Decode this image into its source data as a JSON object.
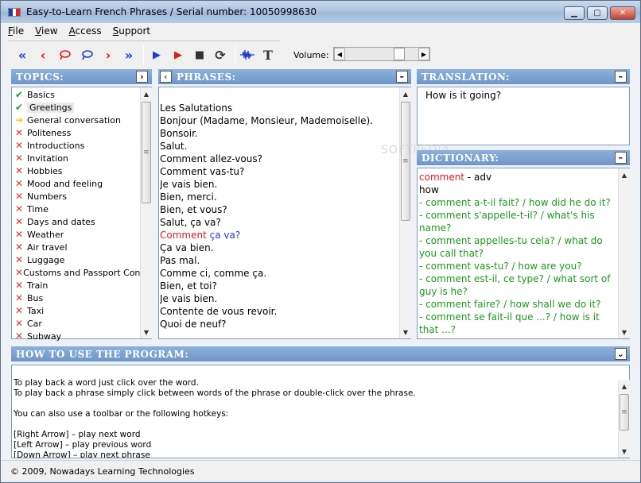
{
  "window": {
    "title": "Easy-to-Learn French Phrases / Serial number: 10050998630",
    "flag_colors": [
      "#1f3fa8",
      "#ffffff",
      "#e0262a"
    ]
  },
  "menu": [
    {
      "label": "File",
      "accel": "F",
      "rest": "ile"
    },
    {
      "label": "View",
      "accel": "V",
      "rest": "iew"
    },
    {
      "label": "Access",
      "accel": "A",
      "rest": "ccess"
    },
    {
      "label": "Support",
      "accel": "S",
      "rest": "upport"
    }
  ],
  "toolbar": {
    "first_glyph": "«",
    "prev_glyph": "‹",
    "next_glyph": "›",
    "last_glyph": "»",
    "play_glyph": "▶",
    "stop_glyph": "■",
    "repeat_glyph": "⟳",
    "wave_glyph": "∿",
    "text_glyph": "T",
    "volume_label": "Volume:",
    "volume_level": 0.78
  },
  "topics": {
    "header": "TOPICS:",
    "items": [
      {
        "label": "Basics",
        "status": "done"
      },
      {
        "label": "Greetings",
        "status": "done"
      },
      {
        "label": "General conversation",
        "status": "current"
      },
      {
        "label": "Politeness",
        "status": "locked"
      },
      {
        "label": "Introductions",
        "status": "locked"
      },
      {
        "label": "Invitation",
        "status": "locked"
      },
      {
        "label": "Hobbies",
        "status": "locked"
      },
      {
        "label": "Mood and feeling",
        "status": "locked"
      },
      {
        "label": "Numbers",
        "status": "locked"
      },
      {
        "label": "Time",
        "status": "locked"
      },
      {
        "label": "Days and dates",
        "status": "locked"
      },
      {
        "label": "Weather",
        "status": "locked"
      },
      {
        "label": "Air travel",
        "status": "locked"
      },
      {
        "label": "Luggage",
        "status": "locked"
      },
      {
        "label": "Customs and Passport Con...",
        "status": "locked"
      },
      {
        "label": "Train",
        "status": "locked"
      },
      {
        "label": "Bus",
        "status": "locked"
      },
      {
        "label": "Taxi",
        "status": "locked"
      },
      {
        "label": "Car",
        "status": "locked"
      },
      {
        "label": "Subway",
        "status": "locked"
      }
    ]
  },
  "phrases": {
    "header": "PHRASES:",
    "lines": [
      "Les Salutations",
      "",
      "Bonjour (Madame, Monsieur, Mademoiselle).",
      "Bonsoir.",
      "Salut.",
      "Comment allez-vous?",
      "Comment vas-tu?",
      "Je vais bien.",
      "Bien, merci.",
      "Bien, et vous?",
      "Salut, ça va?",
      "",
      "Ça va bien.",
      "Pas mal.",
      "Comme ci, comme ça.",
      "Bien, et toi?",
      "Je vais bien.",
      "Contente de vous revoir.",
      "Quoi de neuf?"
    ],
    "highlight": {
      "word": "Comment",
      "rest": " ça va?"
    }
  },
  "translation": {
    "header": "TRANSLATION:",
    "text": "How is it going?"
  },
  "dictionary": {
    "header": "DICTIONARY:",
    "word": "comment",
    "pos": " - adv",
    "meaning": "how",
    "examples": [
      " - comment a-t-il fait? / how did he do it?",
      " - comment s'appelle-t-il? / what's his",
      "name?",
      " - comment appelles-tu cela? / what do",
      "you call that?",
      " - comment vas-tu? / how are you?",
      " - comment est-il, ce type? / what sort of",
      "guy is he?",
      " - comment faire? / how shall we do it?",
      " - comment se fait-il que ...? / how is it",
      "that ...?"
    ]
  },
  "help": {
    "header": "HOW TO USE THE PROGRAM:",
    "lines": [
      "To play back a word just click over the word.",
      "To play back a phrase simply click between words of the phrase or double-click over the phrase.",
      "",
      "You can also use a toolbar or the following hotkeys:",
      "",
      "[Right Arrow] – play next word",
      "[Left Arrow] – play previous word",
      "[Down Arrow] – play next phrase"
    ]
  },
  "watermark": "SOFTPEDIA",
  "status": "© 2009, Nowadays Learning Technologies"
}
